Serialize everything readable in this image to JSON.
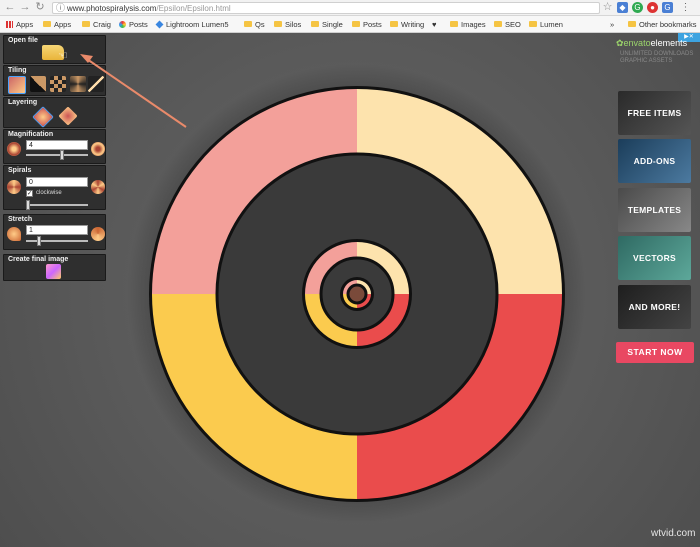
{
  "browser": {
    "url_host": "www.photospiralysis.com",
    "url_path": "/Epsilon/Epsilon.html",
    "bookmarks": [
      {
        "label": "Apps",
        "type": "apps"
      },
      {
        "label": "Apps",
        "type": "folder"
      },
      {
        "label": "Craig",
        "type": "folder"
      },
      {
        "label": "Posts",
        "type": "pinwheel"
      },
      {
        "label": "Lightroom Lumen5",
        "type": "dropbox"
      },
      {
        "label": "Qs",
        "type": "folder"
      },
      {
        "label": "Silos",
        "type": "folder"
      },
      {
        "label": "Single",
        "type": "folder"
      },
      {
        "label": "Posts",
        "type": "folder"
      },
      {
        "label": "Writing",
        "type": "folder"
      },
      {
        "label": "Images",
        "type": "folder"
      },
      {
        "label": "SEO",
        "type": "folder"
      },
      {
        "label": "Lumen",
        "type": "folder"
      }
    ],
    "overflow": "»",
    "other_bookmarks": "Other bookmarks"
  },
  "tools": {
    "open_file": {
      "title": "Open file"
    },
    "tiling": {
      "title": "Tiling"
    },
    "layering": {
      "title": "Layering"
    },
    "magnification": {
      "title": "Magnification",
      "value": "4"
    },
    "spirals": {
      "title": "Spirals",
      "value": "0",
      "clockwise_label": "clockwise"
    },
    "stretch": {
      "title": "Stretch",
      "value": "1"
    },
    "create": {
      "title": "Create final image"
    }
  },
  "ad": {
    "brand": "envato",
    "brand_suffix": "elements",
    "tagline": "UNLIMITED DOWNLOADS GRAPHIC ASSETS",
    "tiles": [
      "FREE ITEMS",
      "ADD-ONS",
      "TEMPLATES",
      "VECTORS",
      "AND MORE!"
    ],
    "cta": "START NOW"
  },
  "watermark": "wtvid.com",
  "colors": {
    "pink": "#f3a09a",
    "cream": "#fde3ad",
    "yellow": "#fbcb4e",
    "red": "#ea4c4c",
    "cta": "#e94862"
  }
}
